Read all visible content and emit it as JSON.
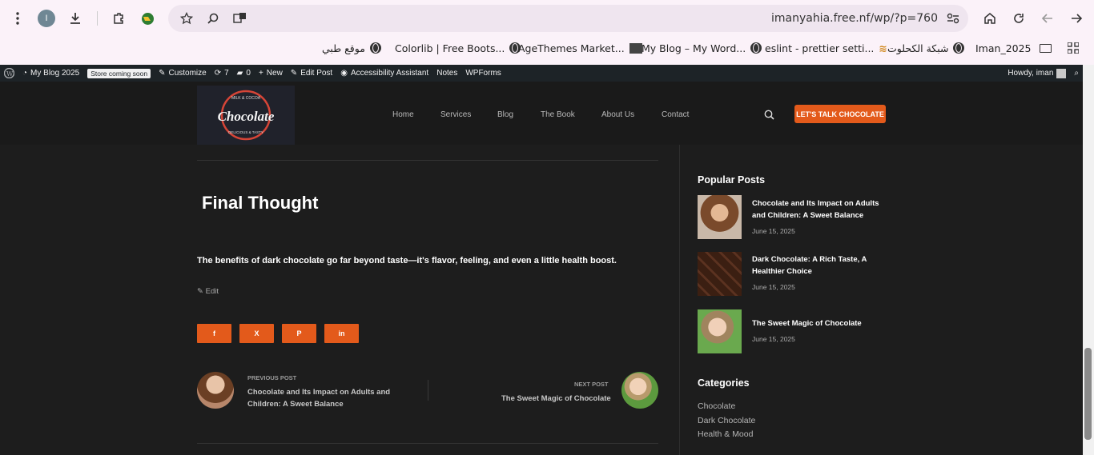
{
  "browser": {
    "url": "imanyahia.free.nf/wp/?p=760",
    "profile_initial": "I",
    "bookmarks": [
      "موقع طبي",
      "Colorlib | Free Boots...",
      "AgeThemes Market...",
      "My Blog – My Word...",
      "eslint - prettier setti...",
      "شبكة الكحلوت",
      "Iman_2025"
    ]
  },
  "wp_admin_bar": {
    "site_name": "My Blog 2025",
    "store_badge": "Store coming soon",
    "customize": "Customize",
    "updates_count": "7",
    "comments_count": "0",
    "new": "New",
    "edit_post": "Edit Post",
    "accessibility": "Accessibility Assistant",
    "notes": "Notes",
    "wpforms": "WPForms",
    "greeting": "Howdy, iman"
  },
  "header": {
    "logo_text": "Chocolate",
    "logo_top": "MILK & COCOA",
    "logo_bottom": "DELICIOUS & TASTY",
    "nav": [
      "Home",
      "Services",
      "Blog",
      "The Book",
      "About Us",
      "Contact"
    ],
    "cta": "LET'S TALK CHOCOLATE"
  },
  "article": {
    "heading": "Final Thought",
    "excerpt": "The benefits of dark chocolate go far beyond taste—it's flavor, feeling, and even a little health boost.",
    "edit_label": "Edit",
    "share": [
      "f",
      "X",
      "P",
      "in"
    ]
  },
  "post_nav": {
    "prev_label": "PREVIOUS POST",
    "prev_title_1": "Chocolate and Its Impact on Adults and",
    "prev_title_2": "Children: A Sweet Balance",
    "next_label": "NEXT POST",
    "next_title": "The Sweet Magic of Chocolate"
  },
  "sidebar": {
    "popular_heading": "Popular Posts",
    "posts": [
      {
        "title_1": "Chocolate and Its Impact on Adults",
        "title_2": "and Children: A Sweet Balance",
        "date": "June 15, 2025"
      },
      {
        "title_1": "Dark Chocolate: A Rich Taste, A",
        "title_2": "Healthier Choice",
        "date": "June 15, 2025"
      },
      {
        "title_1": "The Sweet Magic of Chocolate",
        "title_2": "",
        "date": "June 15, 2025"
      }
    ],
    "categories_heading": "Categories",
    "categories": [
      "Chocolate",
      "Dark Chocolate",
      "Health & Mood"
    ]
  }
}
